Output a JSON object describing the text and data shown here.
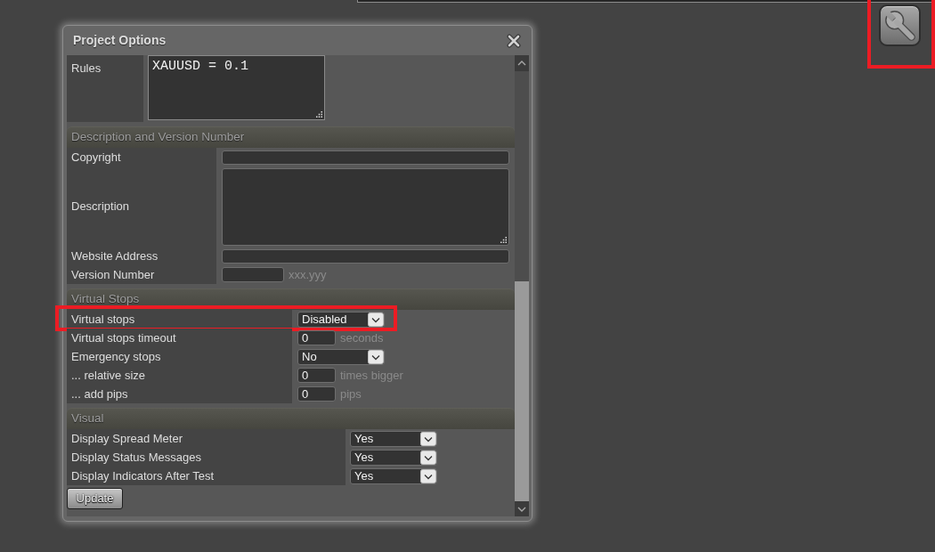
{
  "dialog": {
    "title": "Project Options",
    "sections": [
      {
        "rows": [
          {
            "label": "Rules",
            "kind": "code",
            "value": "XAUUSD = 0.1",
            "highlighted": false
          }
        ]
      },
      {
        "title": "Description and Version Number",
        "rows": [
          {
            "label": "Copyright",
            "kind": "text",
            "highlighted": false
          },
          {
            "label": "Description",
            "kind": "textarea",
            "highlighted": false
          },
          {
            "label": "Website Address",
            "kind": "text",
            "highlighted": false
          },
          {
            "label": "Version Number",
            "kind": "short",
            "hint": "xxx.yyy",
            "highlighted": false
          }
        ]
      },
      {
        "title": "Virtual Stops",
        "rows": [
          {
            "label": "Virtual stops",
            "kind": "select",
            "value": "Disabled",
            "highlighted": true
          },
          {
            "label": "Virtual stops timeout",
            "kind": "number",
            "value": "0",
            "unit": "seconds",
            "highlighted": false
          },
          {
            "label": "Emergency stops",
            "kind": "select",
            "value": "No",
            "highlighted": false
          },
          {
            "label": "... relative size",
            "kind": "number",
            "value": "0",
            "unit": "times bigger",
            "highlighted": false
          },
          {
            "label": "... add pips",
            "kind": "number",
            "value": "0",
            "unit": "pips",
            "highlighted": false
          }
        ]
      },
      {
        "title": "Visual",
        "rows": [
          {
            "label": "Display Spread Meter",
            "kind": "select",
            "value": "Yes",
            "highlighted": false
          },
          {
            "label": "Display Status Messages",
            "kind": "select",
            "value": "Yes",
            "highlighted": false
          },
          {
            "label": "Display Indicators After Test",
            "kind": "select",
            "value": "Yes",
            "highlighted": false
          }
        ]
      }
    ],
    "update_button": "Update"
  },
  "tool_button": {
    "highlighted": true
  }
}
